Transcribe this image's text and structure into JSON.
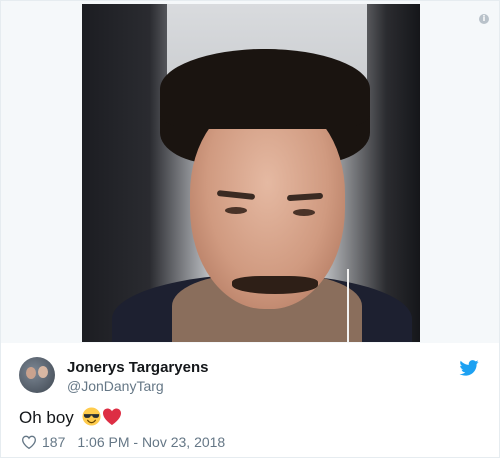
{
  "tweet": {
    "author_name": "Jonerys Targaryens",
    "author_handle": "@JonDanyTarg",
    "text": "Oh boy",
    "emojis": [
      "smiling-face-with-sunglasses",
      "red-heart"
    ],
    "like_count": "187",
    "timestamp": "1:06 PM - Nov 23, 2018"
  },
  "icons": {
    "info": "i",
    "brand": "twitter-bird-icon",
    "like": "heart-outline-icon"
  },
  "colors": {
    "twitter_blue": "#1da1f2",
    "secondary_text": "#657786",
    "heart_red": "#e0245e"
  }
}
